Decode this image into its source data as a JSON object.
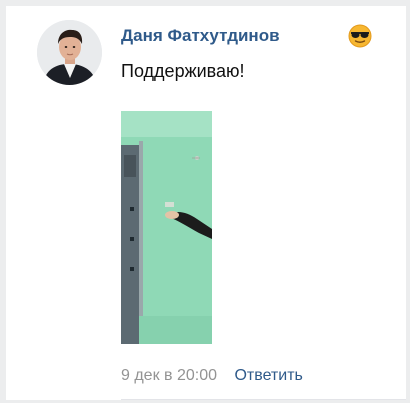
{
  "comment": {
    "author_name": "Даня Фатхутдинов",
    "author_emoji": "sunglasses-emoji",
    "text": "Поддерживаю!",
    "timestamp": "9 дек в 20:00",
    "reply_label": "Ответить"
  },
  "colors": {
    "page_background": "#ecedee",
    "card_background": "#ffffff",
    "author_link": "#2f5a8a",
    "timestamp": "#939393"
  }
}
